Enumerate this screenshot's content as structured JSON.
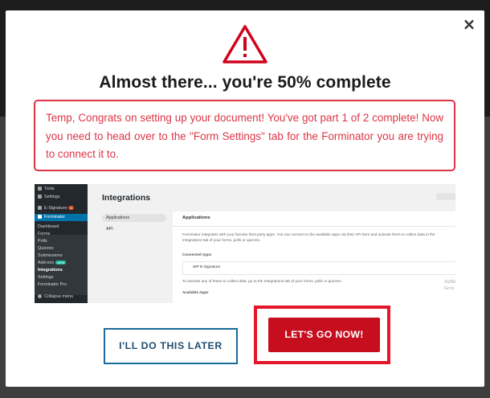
{
  "modal": {
    "title": "Almost there... you're 50% complete",
    "notice": "Temp, Congrats on setting up your document! You've got part 1 of 2 complete! Now you need to head over to the \"Form Settings\" tab for the Forminator you are trying to connect it to.",
    "close_glyph": "×",
    "buttons": {
      "later": "I'LL DO THIS LATER",
      "go": "LET'S GO NOW!"
    },
    "colors": {
      "alert_red": "#dc3545",
      "primary_button": "#c60e1f",
      "secondary_border": "#1a6b9a",
      "highlight_frame": "#e3162a"
    }
  },
  "preview": {
    "sidebar": {
      "tools": "Tools",
      "settings": "Settings",
      "esignature": "E-Signature",
      "esignature_badge": "6",
      "forminator": "Forminator",
      "sub_items": [
        "Dashboard",
        "Forms",
        "Polls",
        "Quizzes",
        "Submissions",
        "Add-ons",
        "Integrations",
        "Settings",
        "Forminator Pro"
      ],
      "addons_badge": "NEW",
      "collapse": "Collapse menu"
    },
    "page_title": "Integrations",
    "top_right_label": "",
    "tabs": [
      "Applications",
      "API"
    ],
    "panel": {
      "heading": "Applications",
      "description_1": "Forminator integrates with your favorite third party apps. You can connect to the available apps via their API here and activate them to collect data in the",
      "description_2": "Integrations tab of your forms, polls or quizzes.",
      "connected_label": "Connected Apps",
      "connected_app": "WP E-Signature",
      "activate_note": "To activate any of these to collect data, go to the Integrations tab of your forms, polls or quizzes.",
      "available_label": "Available Apps"
    },
    "watermark_1": "Activate Windows",
    "watermark_2": "Go to Settings to activate Windows."
  }
}
